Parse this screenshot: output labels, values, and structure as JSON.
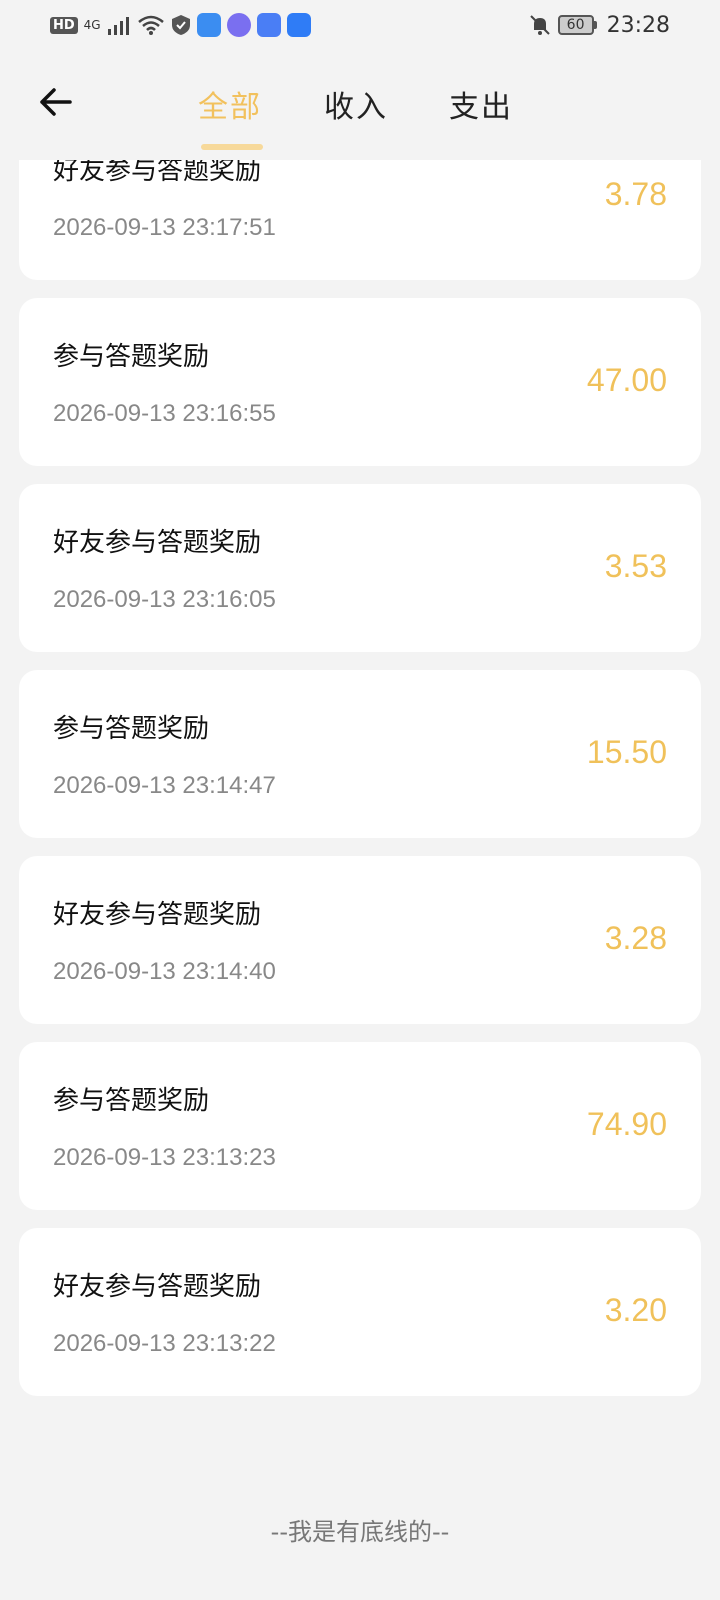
{
  "status_bar": {
    "hd": "HD",
    "network": "4G",
    "battery": "60",
    "time": "23:28"
  },
  "nav": {
    "tabs": [
      {
        "label": "全部",
        "active": true
      },
      {
        "label": "收入",
        "active": false
      },
      {
        "label": "支出",
        "active": false
      }
    ]
  },
  "records": [
    {
      "title": "好友参与答题奖励",
      "time": "2026-09-13 23:17:51",
      "amount": "3.78"
    },
    {
      "title": "参与答题奖励",
      "time": "2026-09-13 23:16:55",
      "amount": "47.00"
    },
    {
      "title": "好友参与答题奖励",
      "time": "2026-09-13 23:16:05",
      "amount": "3.53"
    },
    {
      "title": "参与答题奖励",
      "time": "2026-09-13 23:14:47",
      "amount": "15.50"
    },
    {
      "title": "好友参与答题奖励",
      "time": "2026-09-13 23:14:40",
      "amount": "3.28"
    },
    {
      "title": "参与答题奖励",
      "time": "2026-09-13 23:13:23",
      "amount": "74.90"
    },
    {
      "title": "好友参与答题奖励",
      "time": "2026-09-13 23:13:22",
      "amount": "3.20"
    }
  ],
  "footer": "--我是有底线的--",
  "colors": {
    "accent": "#f0c15a",
    "background": "#f3f3f3"
  }
}
